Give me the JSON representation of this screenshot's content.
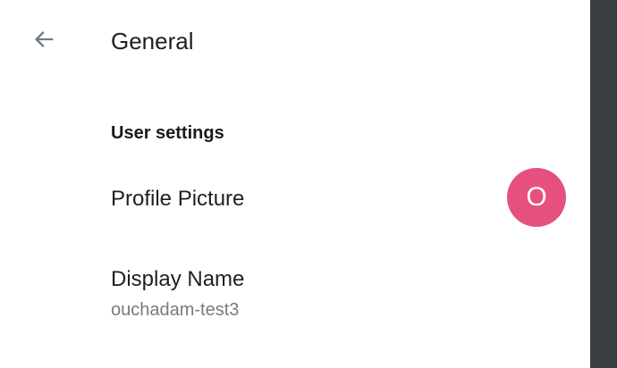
{
  "header": {
    "back_icon": "arrow-left-icon",
    "title": "General"
  },
  "section": {
    "title": "User settings"
  },
  "profile_picture": {
    "label": "Profile Picture",
    "avatar_initial": "O",
    "avatar_color": "#e6507e"
  },
  "display_name": {
    "label": "Display Name",
    "value": "ouchadam-test3"
  },
  "colors": {
    "background": "#ffffff",
    "side_strip": "#3a3d40",
    "icon": "#6f7a85"
  }
}
